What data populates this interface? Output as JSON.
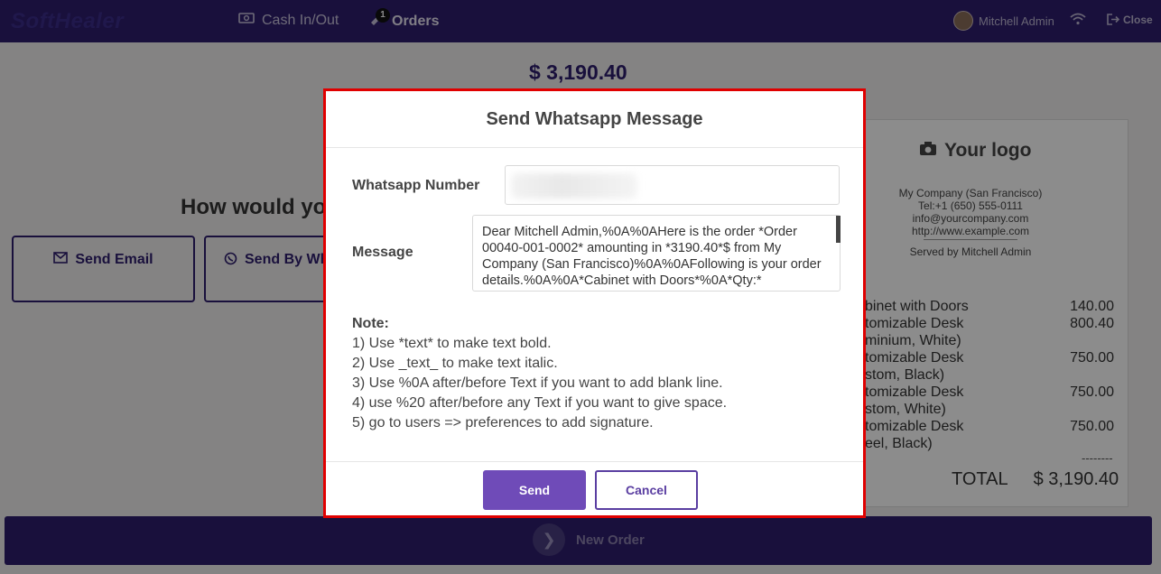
{
  "topbar": {
    "brand": "SoftHealer",
    "cash_label": "Cash In/Out",
    "orders_label": "Orders",
    "orders_badge": "1",
    "user_name": "Mitchell Admin",
    "close_label": "Close"
  },
  "payment": {
    "amount": "$ 3,190.40",
    "prompt": "How would you",
    "send_email": "Send Email",
    "send_whatsapp": "Send By Wh"
  },
  "receipt": {
    "logo": "Your logo",
    "company": "My Company (San Francisco)",
    "tel": "Tel:+1 (650) 555-0111",
    "email": "info@yourcompany.com",
    "website": "http://www.example.com",
    "served_by": "Served by Mitchell Admin",
    "lines": [
      {
        "name": "binet with Doors",
        "price": "140.00"
      },
      {
        "name": "tomizable Desk",
        "price": "800.40"
      },
      {
        "name": "minium, White)",
        "price": ""
      },
      {
        "name": "tomizable Desk",
        "price": "750.00"
      },
      {
        "name": "stom, Black)",
        "price": ""
      },
      {
        "name": "tomizable Desk",
        "price": "750.00"
      },
      {
        "name": "stom, White)",
        "price": ""
      },
      {
        "name": "tomizable Desk",
        "price": "750.00"
      },
      {
        "name": "eel, Black)",
        "price": ""
      }
    ],
    "dashes": "--------",
    "total_label": "TOTAL",
    "total_value": "$ 3,190.40"
  },
  "bottom": {
    "new_order": "New Order"
  },
  "modal": {
    "title": "Send Whatsapp Message",
    "number_label": "Whatsapp Number",
    "number_value": "",
    "message_label": "Message",
    "message_value": "Dear Mitchell Admin,%0A%0AHere is the order *Order 00040-001-0002* amounting in *3190.40*$ from My Company (San Francisco)%0A%0AFollowing is your order details.%0A%0A*Cabinet with Doors*%0A*Qty:*",
    "note_title": "Note:",
    "notes": [
      "1) Use *text* to make text bold.",
      "2) Use _text_ to make text italic.",
      "3) Use %0A after/before Text if you want to add blank line.",
      "4) use %20 after/before any Text if you want to give space.",
      "5) go to users => preferences to add signature."
    ],
    "send_label": "Send",
    "cancel_label": "Cancel"
  }
}
